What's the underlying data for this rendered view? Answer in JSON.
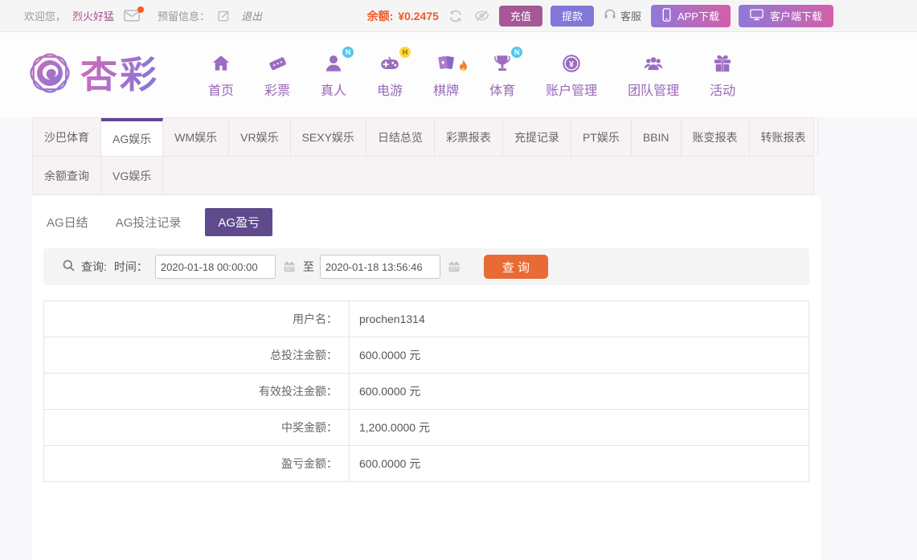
{
  "topbar": {
    "welcome_prefix": "欢迎您，",
    "username": "烈火好猛",
    "reserved_label": "预留信息：",
    "logout": "退出",
    "balance_label": "余额:",
    "balance_value": "¥0.2475",
    "recharge": "充值",
    "withdraw": "提款",
    "service": "客服",
    "app_download": "APP下载",
    "client_download": "客户端下载"
  },
  "brand": {
    "name": "杏彩"
  },
  "nav": {
    "items": [
      {
        "label": "首页",
        "icon": "home-icon",
        "badge": ""
      },
      {
        "label": "彩票",
        "icon": "ticket-icon",
        "badge": ""
      },
      {
        "label": "真人",
        "icon": "live-person-icon",
        "badge": "N"
      },
      {
        "label": "电游",
        "icon": "gamepad-icon",
        "badge": "H"
      },
      {
        "label": "棋牌",
        "icon": "cards-icon",
        "badge": "fire"
      },
      {
        "label": "体育",
        "icon": "trophy-icon",
        "badge": "N"
      },
      {
        "label": "账户管理",
        "icon": "account-coin-icon",
        "badge": ""
      },
      {
        "label": "团队管理",
        "icon": "team-icon",
        "badge": ""
      },
      {
        "label": "活动",
        "icon": "gift-icon",
        "badge": ""
      }
    ]
  },
  "tabs": {
    "row1": [
      "沙巴体育",
      "AG娱乐",
      "WM娱乐",
      "VR娱乐",
      "SEXY娱乐",
      "日结总览",
      "彩票报表",
      "充提记录",
      "PT娱乐",
      "BBIN",
      "账变报表",
      "转账报表"
    ],
    "row2": [
      "余额查询",
      "VG娱乐"
    ],
    "active": "AG娱乐"
  },
  "subtabs": {
    "items": [
      "AG日结",
      "AG投注记录",
      "AG盈亏"
    ],
    "active": "AG盈亏"
  },
  "query": {
    "search_label": "查询:",
    "time_label": "时间：",
    "from_value": "2020-01-18 00:00:00",
    "to_separator": "至",
    "to_value": "2020-01-18 13:56:46",
    "submit_label": "查 询"
  },
  "report": {
    "rows": [
      {
        "label": "用户名：",
        "value": "prochen1314"
      },
      {
        "label": "总投注金额：",
        "value": "600.0000 元"
      },
      {
        "label": "有效投注金额：",
        "value": "600.0000 元"
      },
      {
        "label": "中奖金额：",
        "value": "1,200.0000 元"
      },
      {
        "label": "盈亏金额：",
        "value": "600.0000 元"
      }
    ]
  },
  "colors": {
    "accent_purple": "#5f4796",
    "nav_purple": "#9a68b8",
    "subtab_active_bg": "#5e4a8d",
    "query_button_orange": "#ea6a35",
    "balance_orange": "#f05a28",
    "recharge_bg": "#a65795",
    "withdraw_bg": "#8177d6",
    "gradient_button_start": "#9078d8",
    "gradient_button_end": "#d45fa9",
    "username_magenta": "#a4538f",
    "tabbar_bg": "#f7f2f4"
  }
}
